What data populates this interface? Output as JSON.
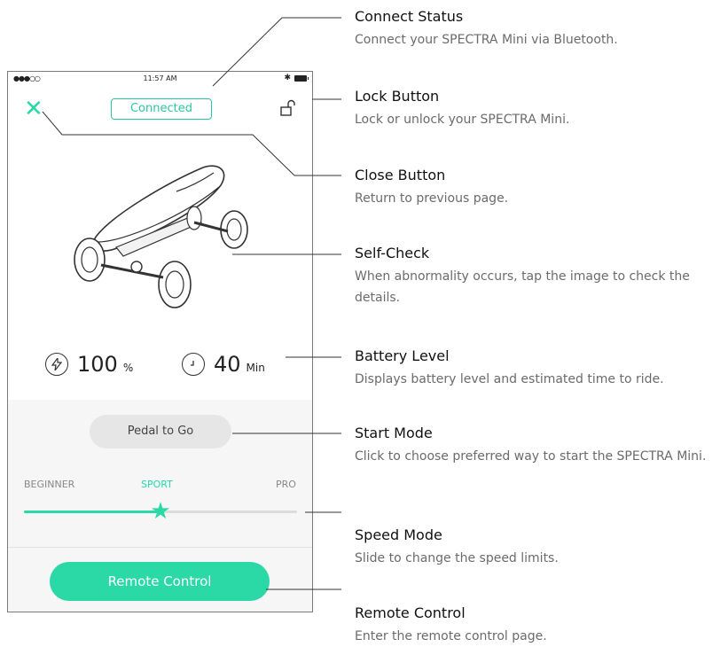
{
  "status_bar": {
    "signal": "●●●○○",
    "time": "11:57 AM",
    "bluetooth": "✱"
  },
  "header": {
    "close_label": "✕",
    "connect_label": "Connected"
  },
  "battery": {
    "level": "100",
    "level_unit": "%",
    "time": "40",
    "time_unit": "Min"
  },
  "start_mode": {
    "label": "Pedal to Go"
  },
  "speed_mode": {
    "options": [
      "BEGINNER",
      "SPORT",
      "PRO"
    ],
    "selected": "SPORT",
    "position": 0.5
  },
  "remote": {
    "label": "Remote Control"
  },
  "annotations": [
    {
      "title": "Connect Status",
      "desc": "Connect your SPECTRA Mini via Bluetooth."
    },
    {
      "title": "Lock Button",
      "desc": "Lock or unlock your SPECTRA Mini."
    },
    {
      "title": "Close Button",
      "desc": "Return to previous page."
    },
    {
      "title": "Self-Check",
      "desc": "When abnormality occurs, tap the image to check the details."
    },
    {
      "title": "Battery Level",
      "desc": "Displays battery level and estimated time to ride."
    },
    {
      "title": "Start Mode",
      "desc": "Click to choose preferred way to start the SPECTRA Mini."
    },
    {
      "title": "Speed Mode",
      "desc": "Slide to change the speed limits."
    },
    {
      "title": "Remote Control",
      "desc": "Enter the remote control page."
    }
  ],
  "colors": {
    "accent": "#2ad9a6",
    "panel": "#f6f6f6",
    "pill": "#e6e6e6"
  },
  "icons": {
    "close": "close-icon",
    "lock": "unlock-icon",
    "bolt": "lightning-icon",
    "clock": "clock-icon",
    "star": "star-icon"
  }
}
